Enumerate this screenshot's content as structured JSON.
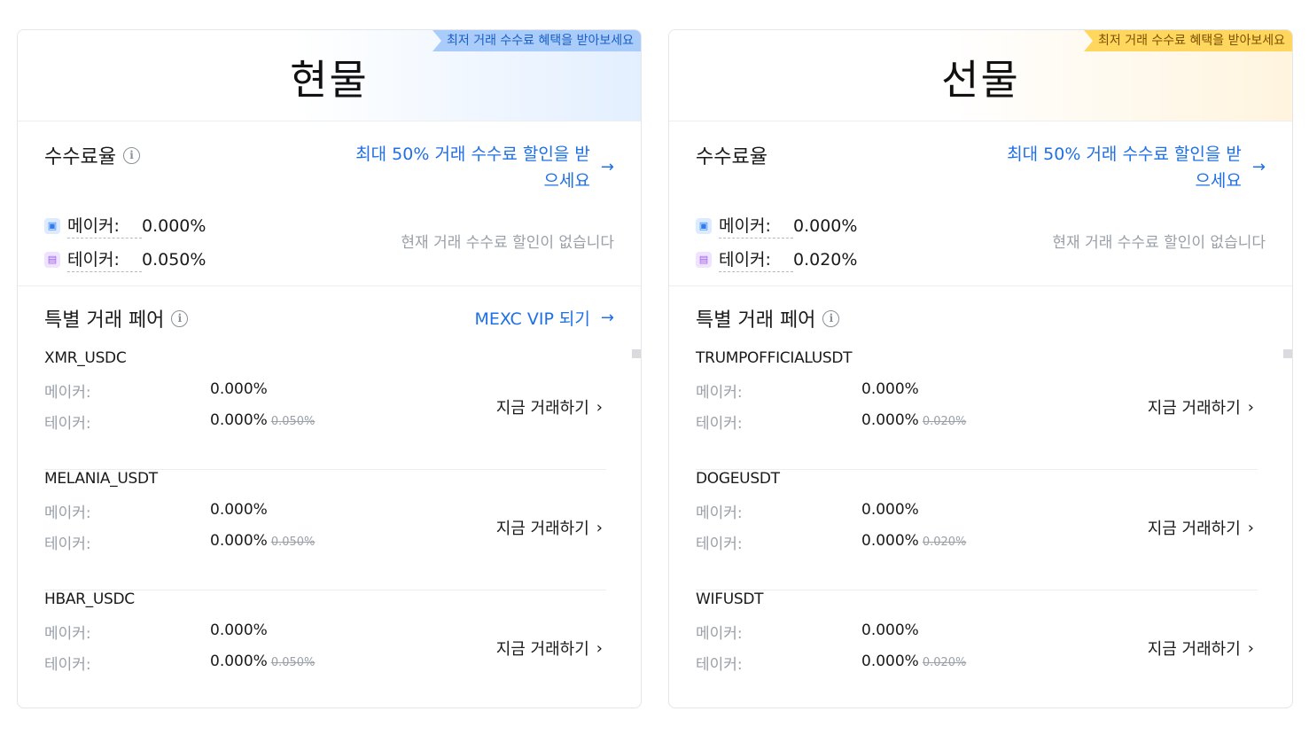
{
  "spot": {
    "title": "현물",
    "ribbon": "최저 거래 수수료 혜택을 받아보세요",
    "fee_title": "수수료율",
    "discount_link": "최대 50% 거래 수수료 할인을 받으세요",
    "maker_label": "메이커:",
    "maker_value": "0.000%",
    "taker_label": "테이커:",
    "taker_value": "0.050%",
    "no_discount": "현재 거래 수수료 할인이 없습니다",
    "pairs_title": "특별 거래 페어",
    "vip_link": "MEXC VIP 되기",
    "pairs": [
      {
        "name": "XMR_USDC",
        "maker_label": "메이커:",
        "maker": "0.000%",
        "taker_label": "테이커:",
        "taker": "0.000%",
        "taker_original": "0.050%",
        "trade": "지금 거래하기"
      },
      {
        "name": "MELANIA_USDT",
        "maker_label": "메이커:",
        "maker": "0.000%",
        "taker_label": "테이커:",
        "taker": "0.000%",
        "taker_original": "0.050%",
        "trade": "지금 거래하기"
      },
      {
        "name": "HBAR_USDC",
        "maker_label": "메이커:",
        "maker": "0.000%",
        "taker_label": "테이커:",
        "taker": "0.000%",
        "taker_original": "0.050%",
        "trade": "지금 거래하기"
      }
    ]
  },
  "futures": {
    "title": "선물",
    "ribbon": "최저 거래 수수료 혜택을 받아보세요",
    "fee_title": "수수료율",
    "discount_link": "최대 50% 거래 수수료 할인을 받으세요",
    "maker_label": "메이커:",
    "maker_value": "0.000%",
    "taker_label": "테이커:",
    "taker_value": "0.020%",
    "no_discount": "현재 거래 수수료 할인이 없습니다",
    "pairs_title": "특별 거래 페어",
    "pairs": [
      {
        "name": "TRUMPOFFICIALUSDT",
        "maker_label": "메이커:",
        "maker": "0.000%",
        "taker_label": "테이커:",
        "taker": "0.000%",
        "taker_original": "0.020%",
        "trade": "지금 거래하기"
      },
      {
        "name": "DOGEUSDT",
        "maker_label": "메이커:",
        "maker": "0.000%",
        "taker_label": "테이커:",
        "taker": "0.000%",
        "taker_original": "0.020%",
        "trade": "지금 거래하기"
      },
      {
        "name": "WIFUSDT",
        "maker_label": "메이커:",
        "maker": "0.000%",
        "taker_label": "테이커:",
        "taker": "0.000%",
        "taker_original": "0.020%",
        "trade": "지금 거래하기"
      }
    ]
  },
  "icons": {
    "info": "info-icon",
    "arrow": "arrow-right-icon",
    "chevron": "chevron-right-icon",
    "maker": "maker-icon",
    "taker": "taker-icon"
  },
  "colors": {
    "link": "#1f6fe5",
    "spot_ribbon": "#a9ccfb",
    "futures_ribbon": "#ffd75e",
    "muted": "#9aa0a8"
  }
}
